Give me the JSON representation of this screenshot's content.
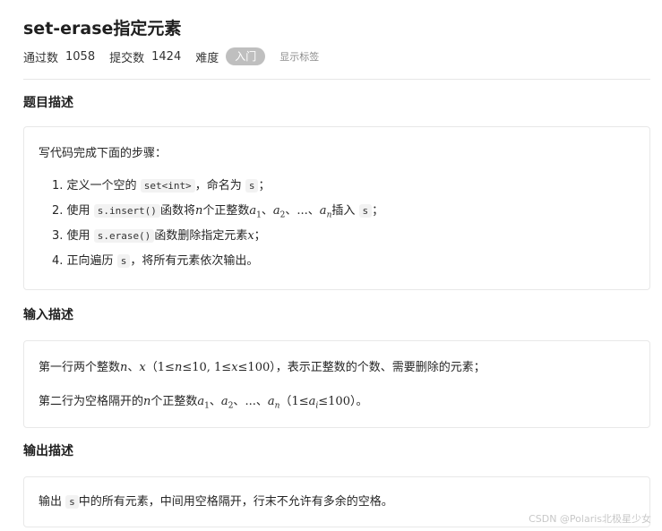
{
  "problem": {
    "title": "set-erase指定元素",
    "stats": {
      "passed_label": "通过数",
      "passed_value": "1058",
      "submitted_label": "提交数",
      "submitted_value": "1424",
      "difficulty_label": "难度",
      "difficulty_value": "入门",
      "show_tags": "显示标签"
    }
  },
  "description": {
    "heading": "题目描述",
    "intro": "写代码完成下面的步骤：",
    "step1": {
      "num": "1.",
      "pre": "定义一个空的",
      "code": "set<int>",
      "mid": "，命名为",
      "code2": "s",
      "post": "；"
    },
    "step2": {
      "num": "2.",
      "pre": "使用",
      "code": "s.insert()",
      "mid": "函数将",
      "n": "n",
      "mid2": "个正整数",
      "a1": "a",
      "s1": "1",
      "sep1": "、",
      "a2": "a",
      "s2": "2",
      "sep2": "、",
      "dots": "...",
      "sep3": "、",
      "an": "a",
      "sn": "n",
      "mid3": "插入",
      "code2": "s",
      "post": "；"
    },
    "step3": {
      "num": "3.",
      "pre": "使用",
      "code": "s.erase()",
      "mid": "函数删除指定元素",
      "x": "x",
      "post": "；"
    },
    "step4": {
      "num": "4.",
      "pre": "正向遍历",
      "code": "s",
      "post": "，将所有元素依次输出。"
    }
  },
  "input": {
    "heading": "输入描述",
    "line1": {
      "pre": "第一行两个整数",
      "n": "n",
      "sep": "、",
      "x": "x",
      "open": "（",
      "c1": "1≤",
      "c1n": "n",
      "c1b": "≤10, 1≤",
      "c1x": "x",
      "c1c": "≤100",
      "close": "）",
      "post": "，表示正整数的个数、需要删除的元素；"
    },
    "line2": {
      "pre": "第二行为空格隔开的",
      "n": "n",
      "mid": "个正整数",
      "a1": "a",
      "s1": "1",
      "sep1": "、",
      "a2": "a",
      "s2": "2",
      "sep2": "、",
      "dots": "...",
      "sep3": "、",
      "an": "a",
      "sn": "n",
      "open": "（",
      "c1": "1≤",
      "ca": "a",
      "ci": "i",
      "c2": "≤100",
      "close": "）",
      "post": "。"
    }
  },
  "output": {
    "heading": "输出描述",
    "pre": "输出",
    "code": "s",
    "post": "中的所有元素，中间用空格隔开，行末不允许有多余的空格。"
  },
  "watermark": "CSDN @Polaris北极星少女"
}
